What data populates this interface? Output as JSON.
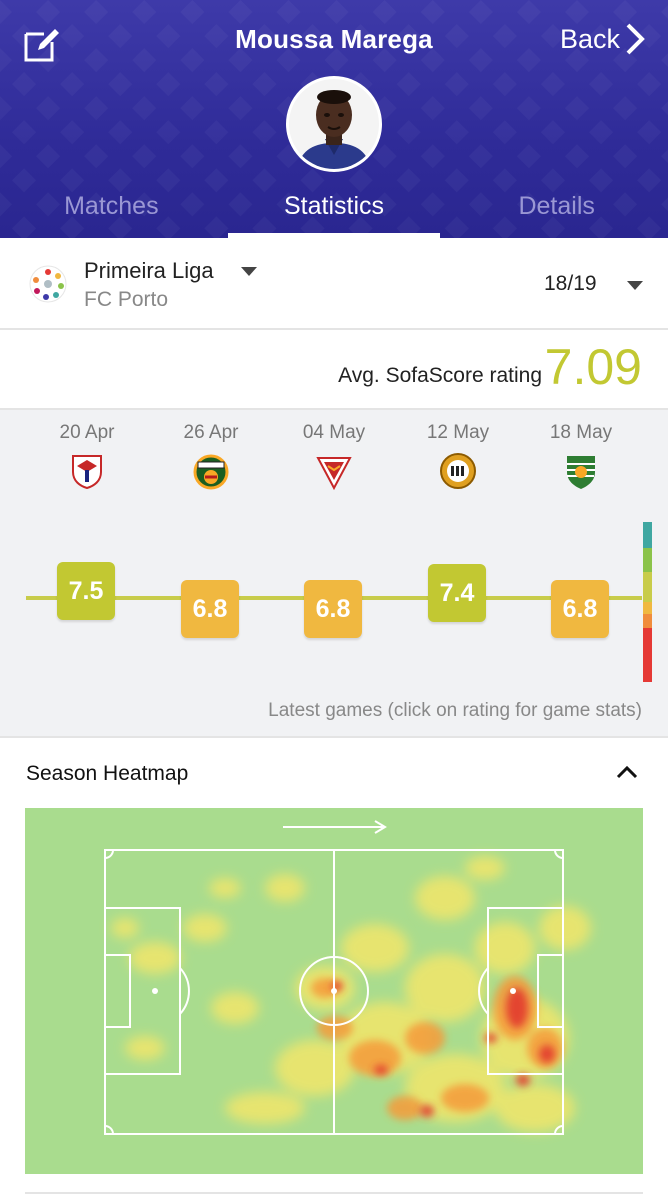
{
  "header": {
    "player_name": "Moussa Marega",
    "back_label": "Back",
    "edit_icon": "edit-icon",
    "back_icon": "chevron-right-icon",
    "gradient_color": "#3e3aa9"
  },
  "tabs": [
    {
      "label": "Matches",
      "active": false
    },
    {
      "label": "Statistics",
      "active": true
    },
    {
      "label": "Details",
      "active": false
    }
  ],
  "league": {
    "name": "Primeira Liga",
    "team": "FC Porto",
    "season": "18/19"
  },
  "rating": {
    "label": "Avg. SofaScore rating",
    "value": "7.09",
    "color": "#c2c832"
  },
  "latest_games": {
    "caption": "Latest games (click on rating for game stats)",
    "games": [
      {
        "date": "20 Apr",
        "rating": "7.5",
        "color": "#c2c832",
        "crest": "santa-clara-crest-icon"
      },
      {
        "date": "26 Apr",
        "rating": "6.8",
        "color": "#f0b840",
        "crest": "rio-ave-crest-icon"
      },
      {
        "date": "04 May",
        "rating": "6.8",
        "color": "#f0b840",
        "crest": "aves-crest-icon"
      },
      {
        "date": "12 May",
        "rating": "7.4",
        "color": "#c2c832",
        "crest": "nacional-crest-icon"
      },
      {
        "date": "18 May",
        "rating": "6.8",
        "color": "#f0b840",
        "crest": "sporting-crest-icon"
      }
    ],
    "scale_colors": [
      "#3fa7a1",
      "#8bc34a",
      "#c8cc4a",
      "#f0b840",
      "#f08c3c",
      "#e53935"
    ]
  },
  "heatmap": {
    "title": "Season Heatmap",
    "collapse_icon": "chevron-up-icon",
    "direction_icon": "arrow-right-icon",
    "pitch_color": "#a9dc8e"
  }
}
